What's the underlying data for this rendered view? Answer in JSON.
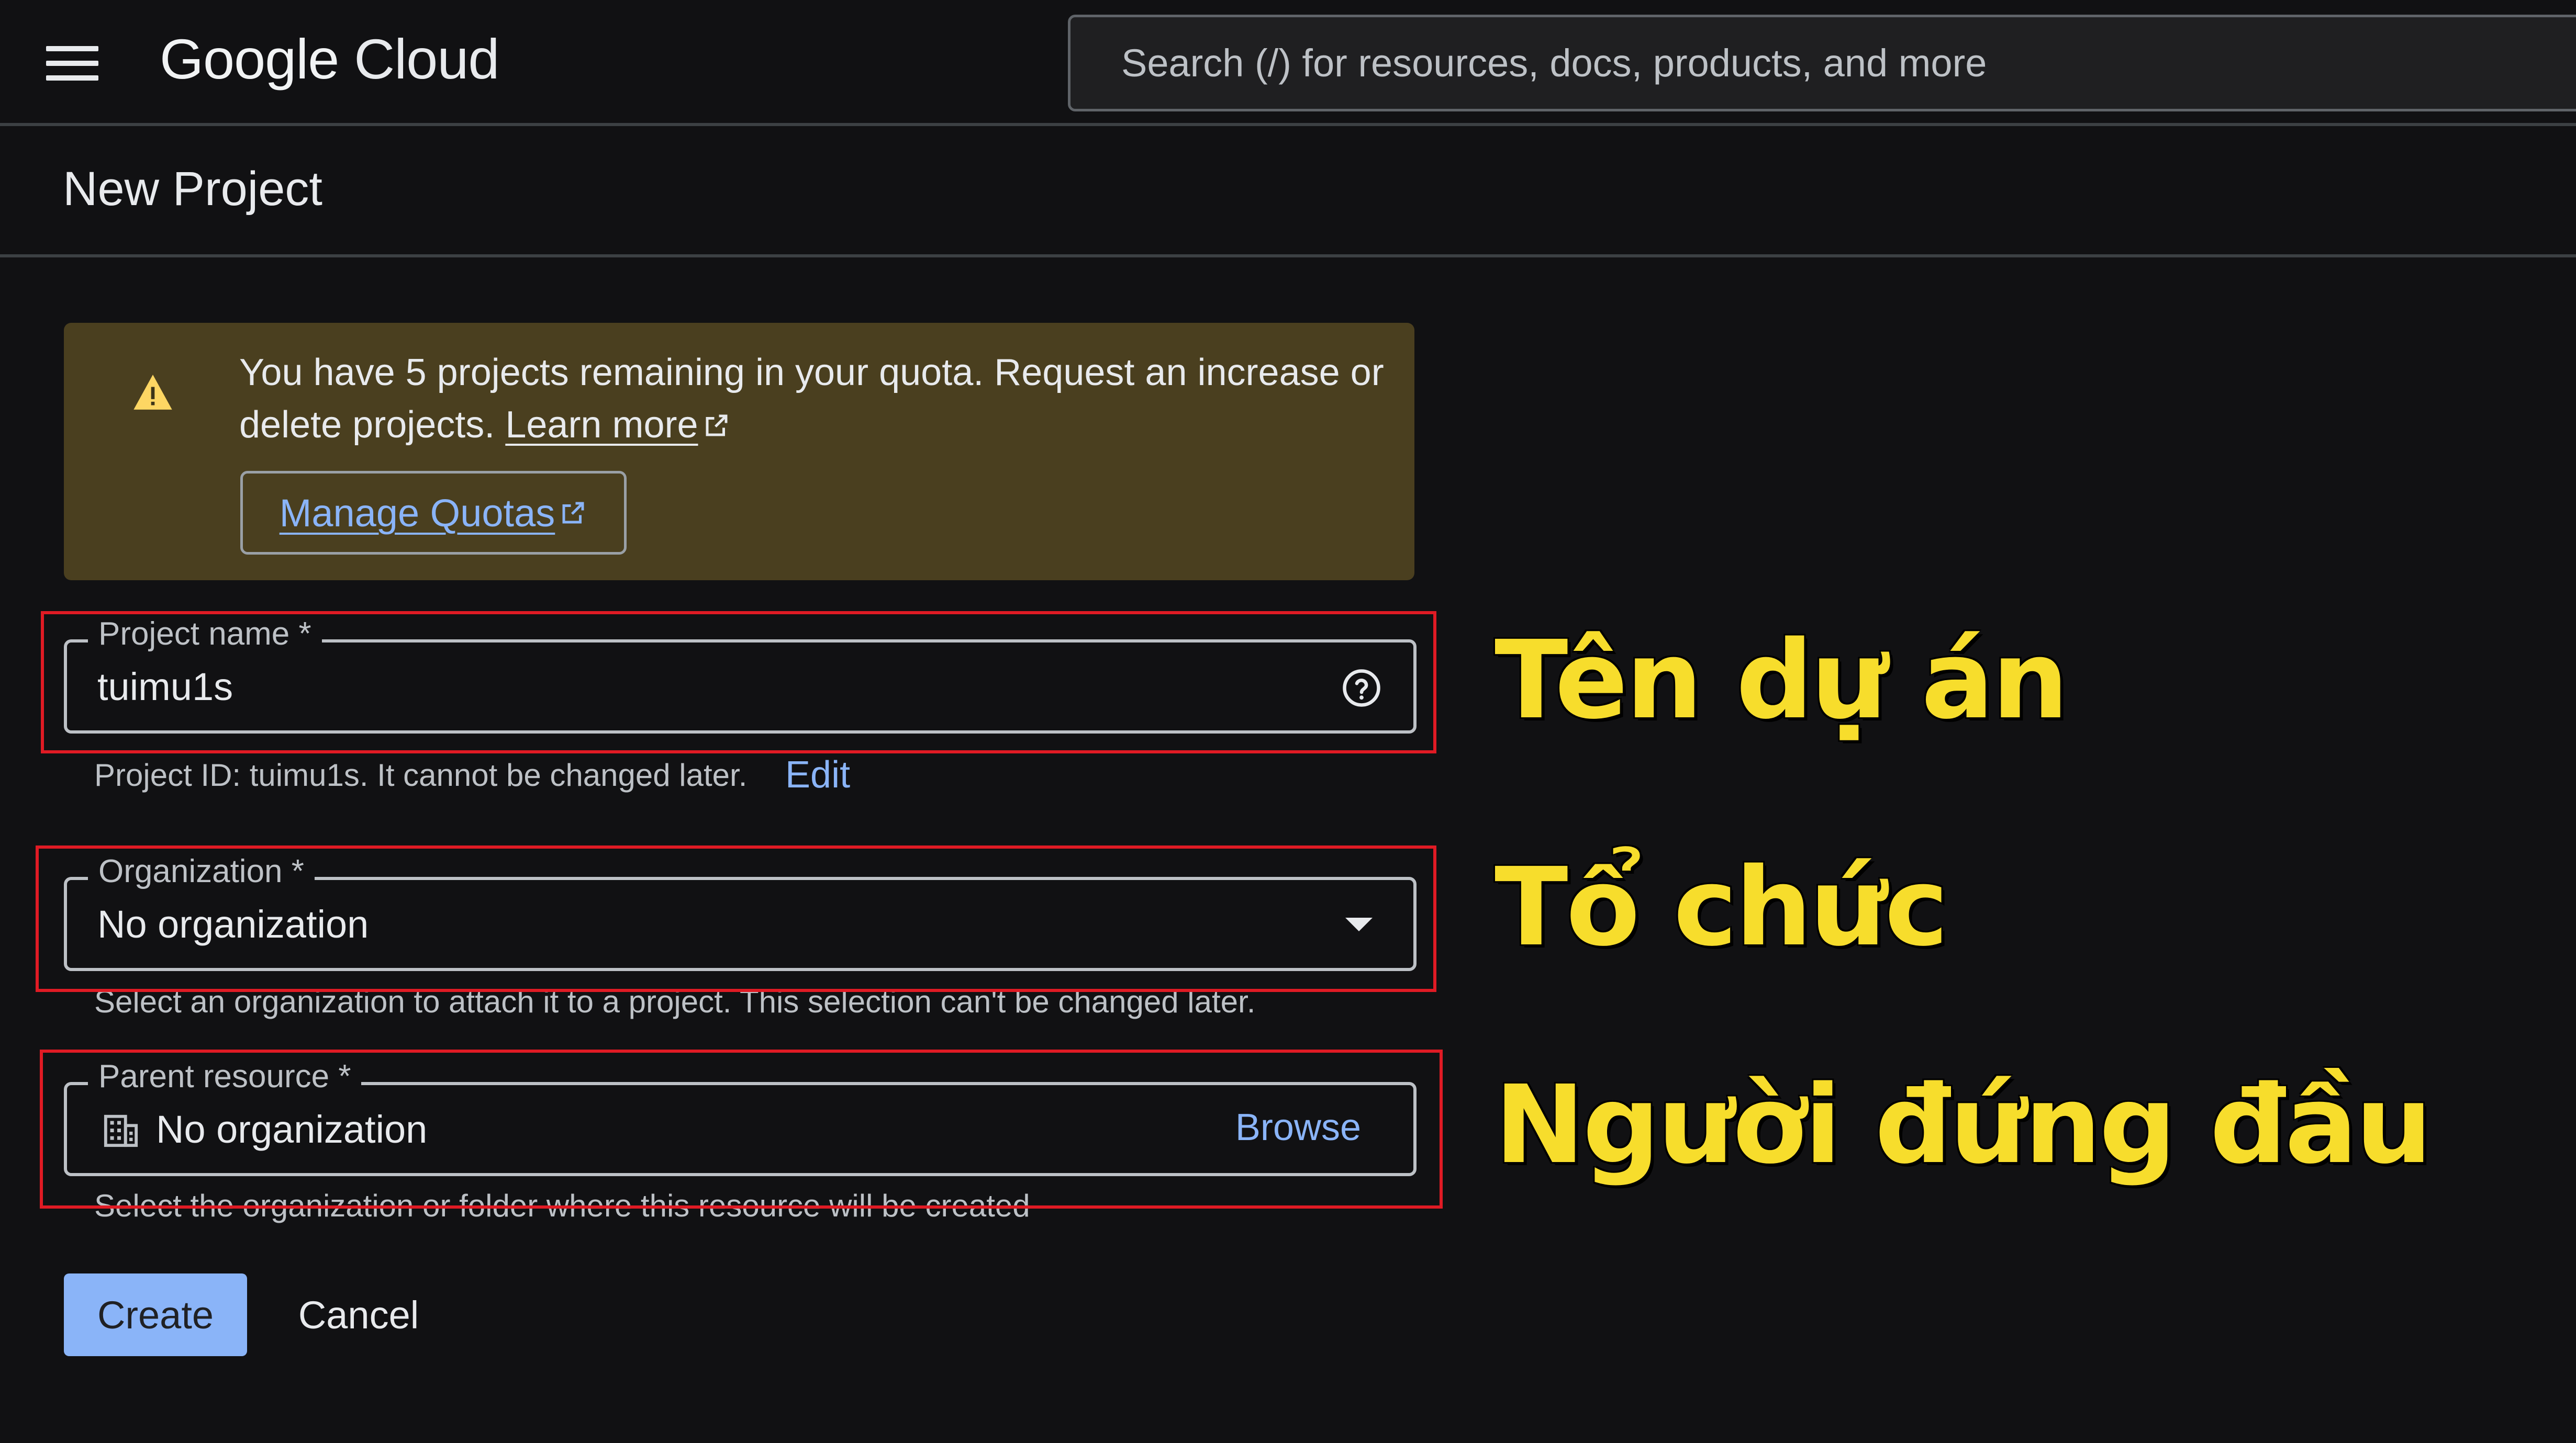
{
  "topbar": {
    "logo_google": "Google",
    "logo_cloud": "Cloud",
    "search_placeholder": "Search (/) for resources, docs, products, and more"
  },
  "page": {
    "title": "New Project"
  },
  "banner": {
    "message": "You have 5 projects remaining in your quota. Request an increase or delete projects.",
    "learn_more": "Learn more",
    "manage_quotas": "Manage Quotas",
    "background_color": "#4a3f1f",
    "icon": "warning-icon"
  },
  "form": {
    "project_name": {
      "label": "Project name *",
      "value": "tuimu1s",
      "help_icon": "help-circle-icon"
    },
    "project_id_hint": "Project ID: tuimu1s. It cannot be changed later.",
    "edit_label": "Edit",
    "organization": {
      "label": "Organization *",
      "value": "No organization",
      "hint": "Select an organization to attach it to a project. This selection can't be changed later."
    },
    "parent_resource": {
      "label": "Parent resource *",
      "value": "No organization",
      "browse": "Browse",
      "hint": "Select the organization or folder where this resource will be created"
    }
  },
  "actions": {
    "create": "Create",
    "cancel": "Cancel"
  },
  "annotations": {
    "project_name": "Tên dự án",
    "organization": "Tổ chức",
    "parent_resource": "Người đứng đầu",
    "color": "#f7dd2c",
    "highlight_color": "#e01b24"
  },
  "colors": {
    "background": "#111113",
    "accent_blue": "#8ab4f8"
  }
}
